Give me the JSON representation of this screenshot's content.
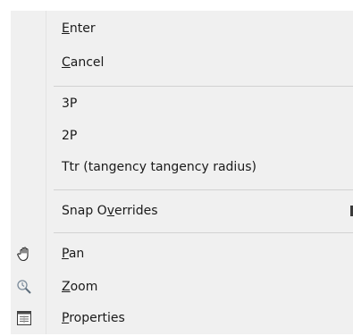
{
  "menu": {
    "items": [
      {
        "label": "Enter",
        "accel_index": 0
      },
      {
        "label": "Cancel",
        "accel_index": 0
      },
      {
        "label": "3P",
        "accel_index": -1
      },
      {
        "label": "2P",
        "accel_index": -1
      },
      {
        "label": "Ttr (tangency tangency radius)",
        "accel_index": -1
      },
      {
        "label": "Snap Overrides",
        "accel_index": 6
      },
      {
        "label": "Pan",
        "accel_index": 0,
        "icon": "pan-hand-icon"
      },
      {
        "label": "Zoom",
        "accel_index": 0,
        "icon": "zoom-realtime-icon"
      },
      {
        "label": "Properties",
        "accel_index": 0,
        "icon": "properties-icon"
      }
    ]
  },
  "colors": {
    "menu_background": "#f0f0f0",
    "separator": "#d2d2d2",
    "text": "#1a1a1a"
  }
}
